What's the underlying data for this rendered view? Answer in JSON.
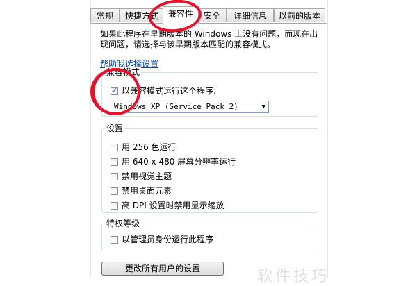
{
  "tabs": [
    {
      "label": "常规",
      "active": false
    },
    {
      "label": "快捷方式",
      "active": false
    },
    {
      "label": "兼容性",
      "active": true
    },
    {
      "label": "安全",
      "active": false
    },
    {
      "label": "详细信息",
      "active": false
    },
    {
      "label": "以前的版本",
      "active": false
    }
  ],
  "intro_text": "如果此程序在早期版本的 Windows 上没有问题，而现在出现问题，请选择与该早期版本匹配的兼容模式。",
  "help_link": "帮助我选择设置",
  "compat_mode": {
    "title": "兼容模式",
    "checkbox_label": "以兼容模式运行这个程序:",
    "checked": true,
    "selected_os": "Windows XP (Service Pack 2)"
  },
  "settings": {
    "title": "设置",
    "items": [
      "用 256 色运行",
      "用 640 x 480 屏幕分辨率运行",
      "禁用视觉主题",
      "禁用桌面元素",
      "高 DPI 设置时禁用显示缩放"
    ]
  },
  "privilege": {
    "title": "特权等级",
    "checkbox_label": "以管理员身份运行此程序"
  },
  "all_users_button": "更改所有用户的设置",
  "watermark": "软件技巧",
  "colors": {
    "annotation": "#e8102a",
    "link": "#0645ad"
  }
}
